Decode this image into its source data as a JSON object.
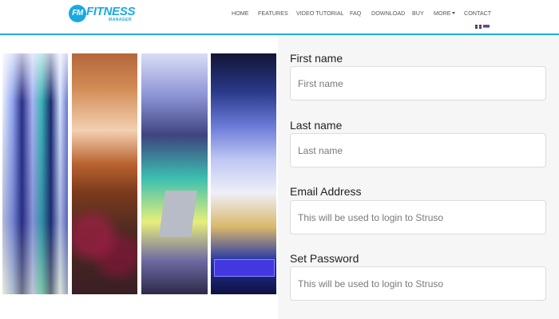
{
  "brand": {
    "badge": "FM",
    "name": "FITNESS",
    "tagline": "MANAGER"
  },
  "nav": {
    "items": [
      "HOME",
      "FEATURES",
      "VIDEO TUTORIAL",
      "FAQ",
      "DOWNLOAD",
      "BUY",
      "MORE",
      "CONTACT"
    ],
    "more_has_dropdown": true
  },
  "languages": [
    "english-flag",
    "serbian-flag"
  ],
  "form": {
    "first_name": {
      "label": "First name",
      "value": "",
      "placeholder": "First name"
    },
    "last_name": {
      "label": "Last name",
      "value": "",
      "placeholder": "Last name"
    },
    "email": {
      "label": "Email Address",
      "value": "",
      "placeholder": "This will be used to login to Struso"
    },
    "password": {
      "label": "Set Password",
      "value": "",
      "placeholder": "This will be used to login to Struso"
    }
  },
  "colors": {
    "accent": "#1eaee4",
    "form_background": "#f6f6f6",
    "nav_text": "#555555"
  }
}
